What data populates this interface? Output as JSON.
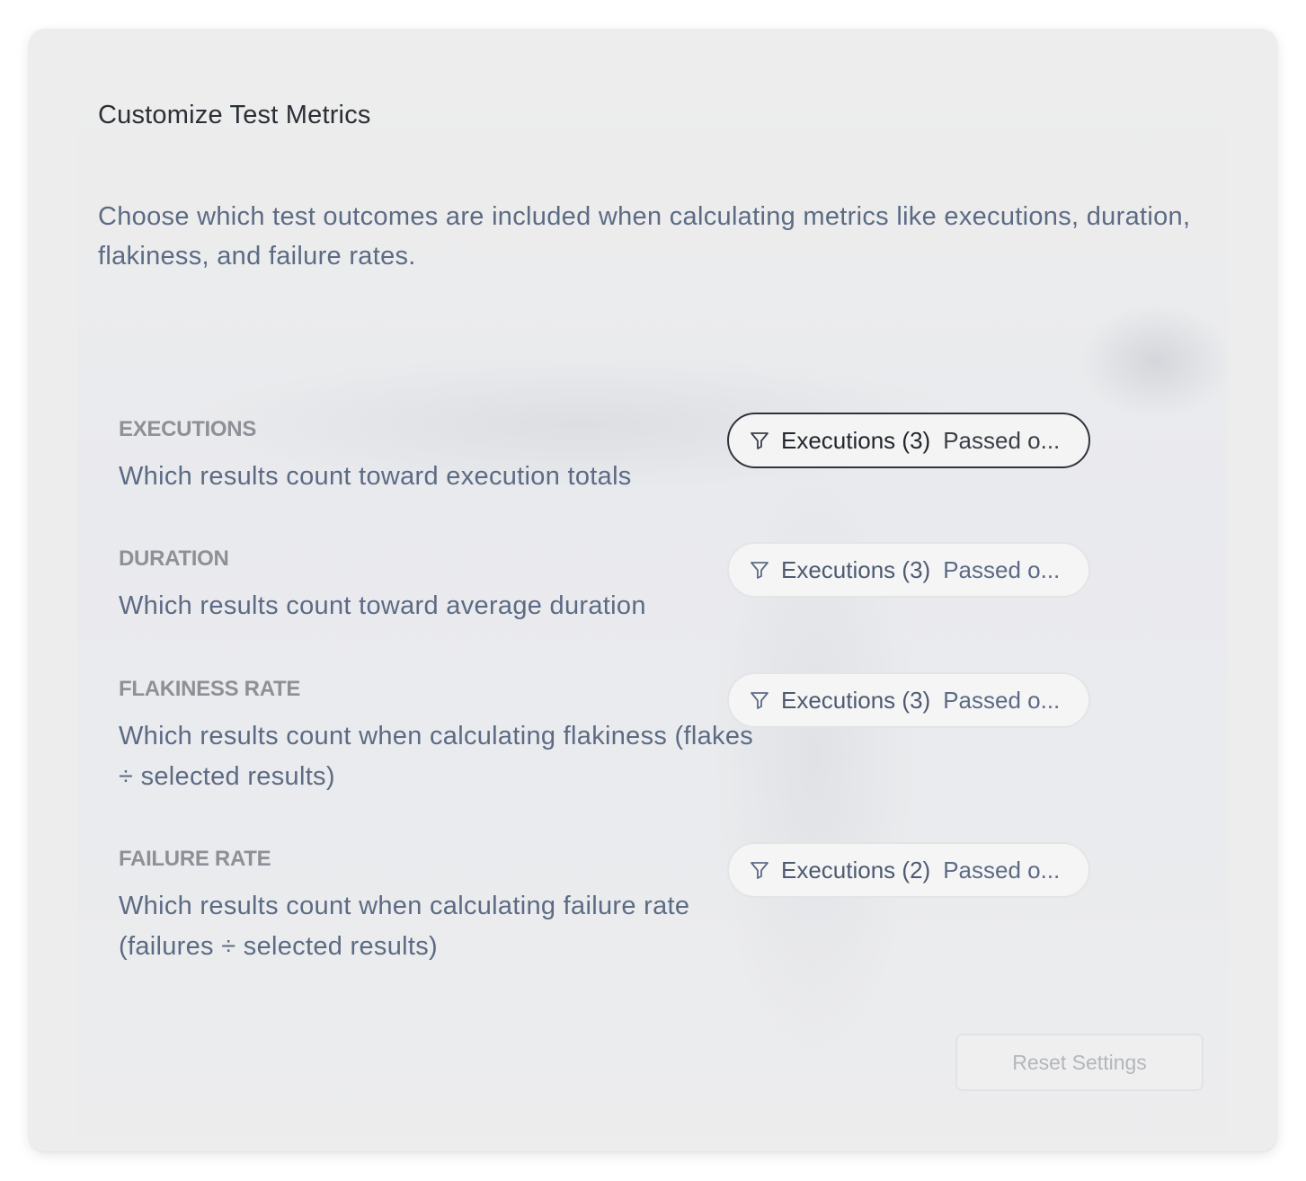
{
  "panel": {
    "title": "Customize Test Metrics",
    "description": "Choose which test outcomes are included when calculating metrics like executions, duration, flakiness, and failure rates."
  },
  "metrics": [
    {
      "label": "EXECUTIONS",
      "description": "Which results count toward execution totals",
      "filter": {
        "primary": "Executions (3)",
        "secondary": "Passed o...",
        "icon": "filter-funnel-icon",
        "focused": true
      }
    },
    {
      "label": "DURATION",
      "description": "Which results count toward average duration",
      "filter": {
        "primary": "Executions (3)",
        "secondary": "Passed o...",
        "icon": "filter-funnel-icon",
        "focused": false
      }
    },
    {
      "label": "FLAKINESS RATE",
      "description": "Which results count when calculating flakiness (flakes ÷ selected results)",
      "filter": {
        "primary": "Executions (3)",
        "secondary": "Passed o...",
        "icon": "filter-funnel-icon",
        "focused": false
      }
    },
    {
      "label": "FAILURE RATE",
      "description": "Which results count when calculating failure rate (failures ÷ selected results)",
      "filter": {
        "primary": "Executions (2)",
        "secondary": "Passed o...",
        "icon": "filter-funnel-icon",
        "focused": false
      }
    }
  ],
  "footer": {
    "reset_label": "Reset Settings",
    "reset_disabled": true
  },
  "colors": {
    "card_background": "#ededed",
    "title": "#2b2f36",
    "body_text": "#5c6b84",
    "section_label": "#8d9096",
    "focus_border": "#2f333a",
    "disabled_text": "#b3b6bb"
  }
}
